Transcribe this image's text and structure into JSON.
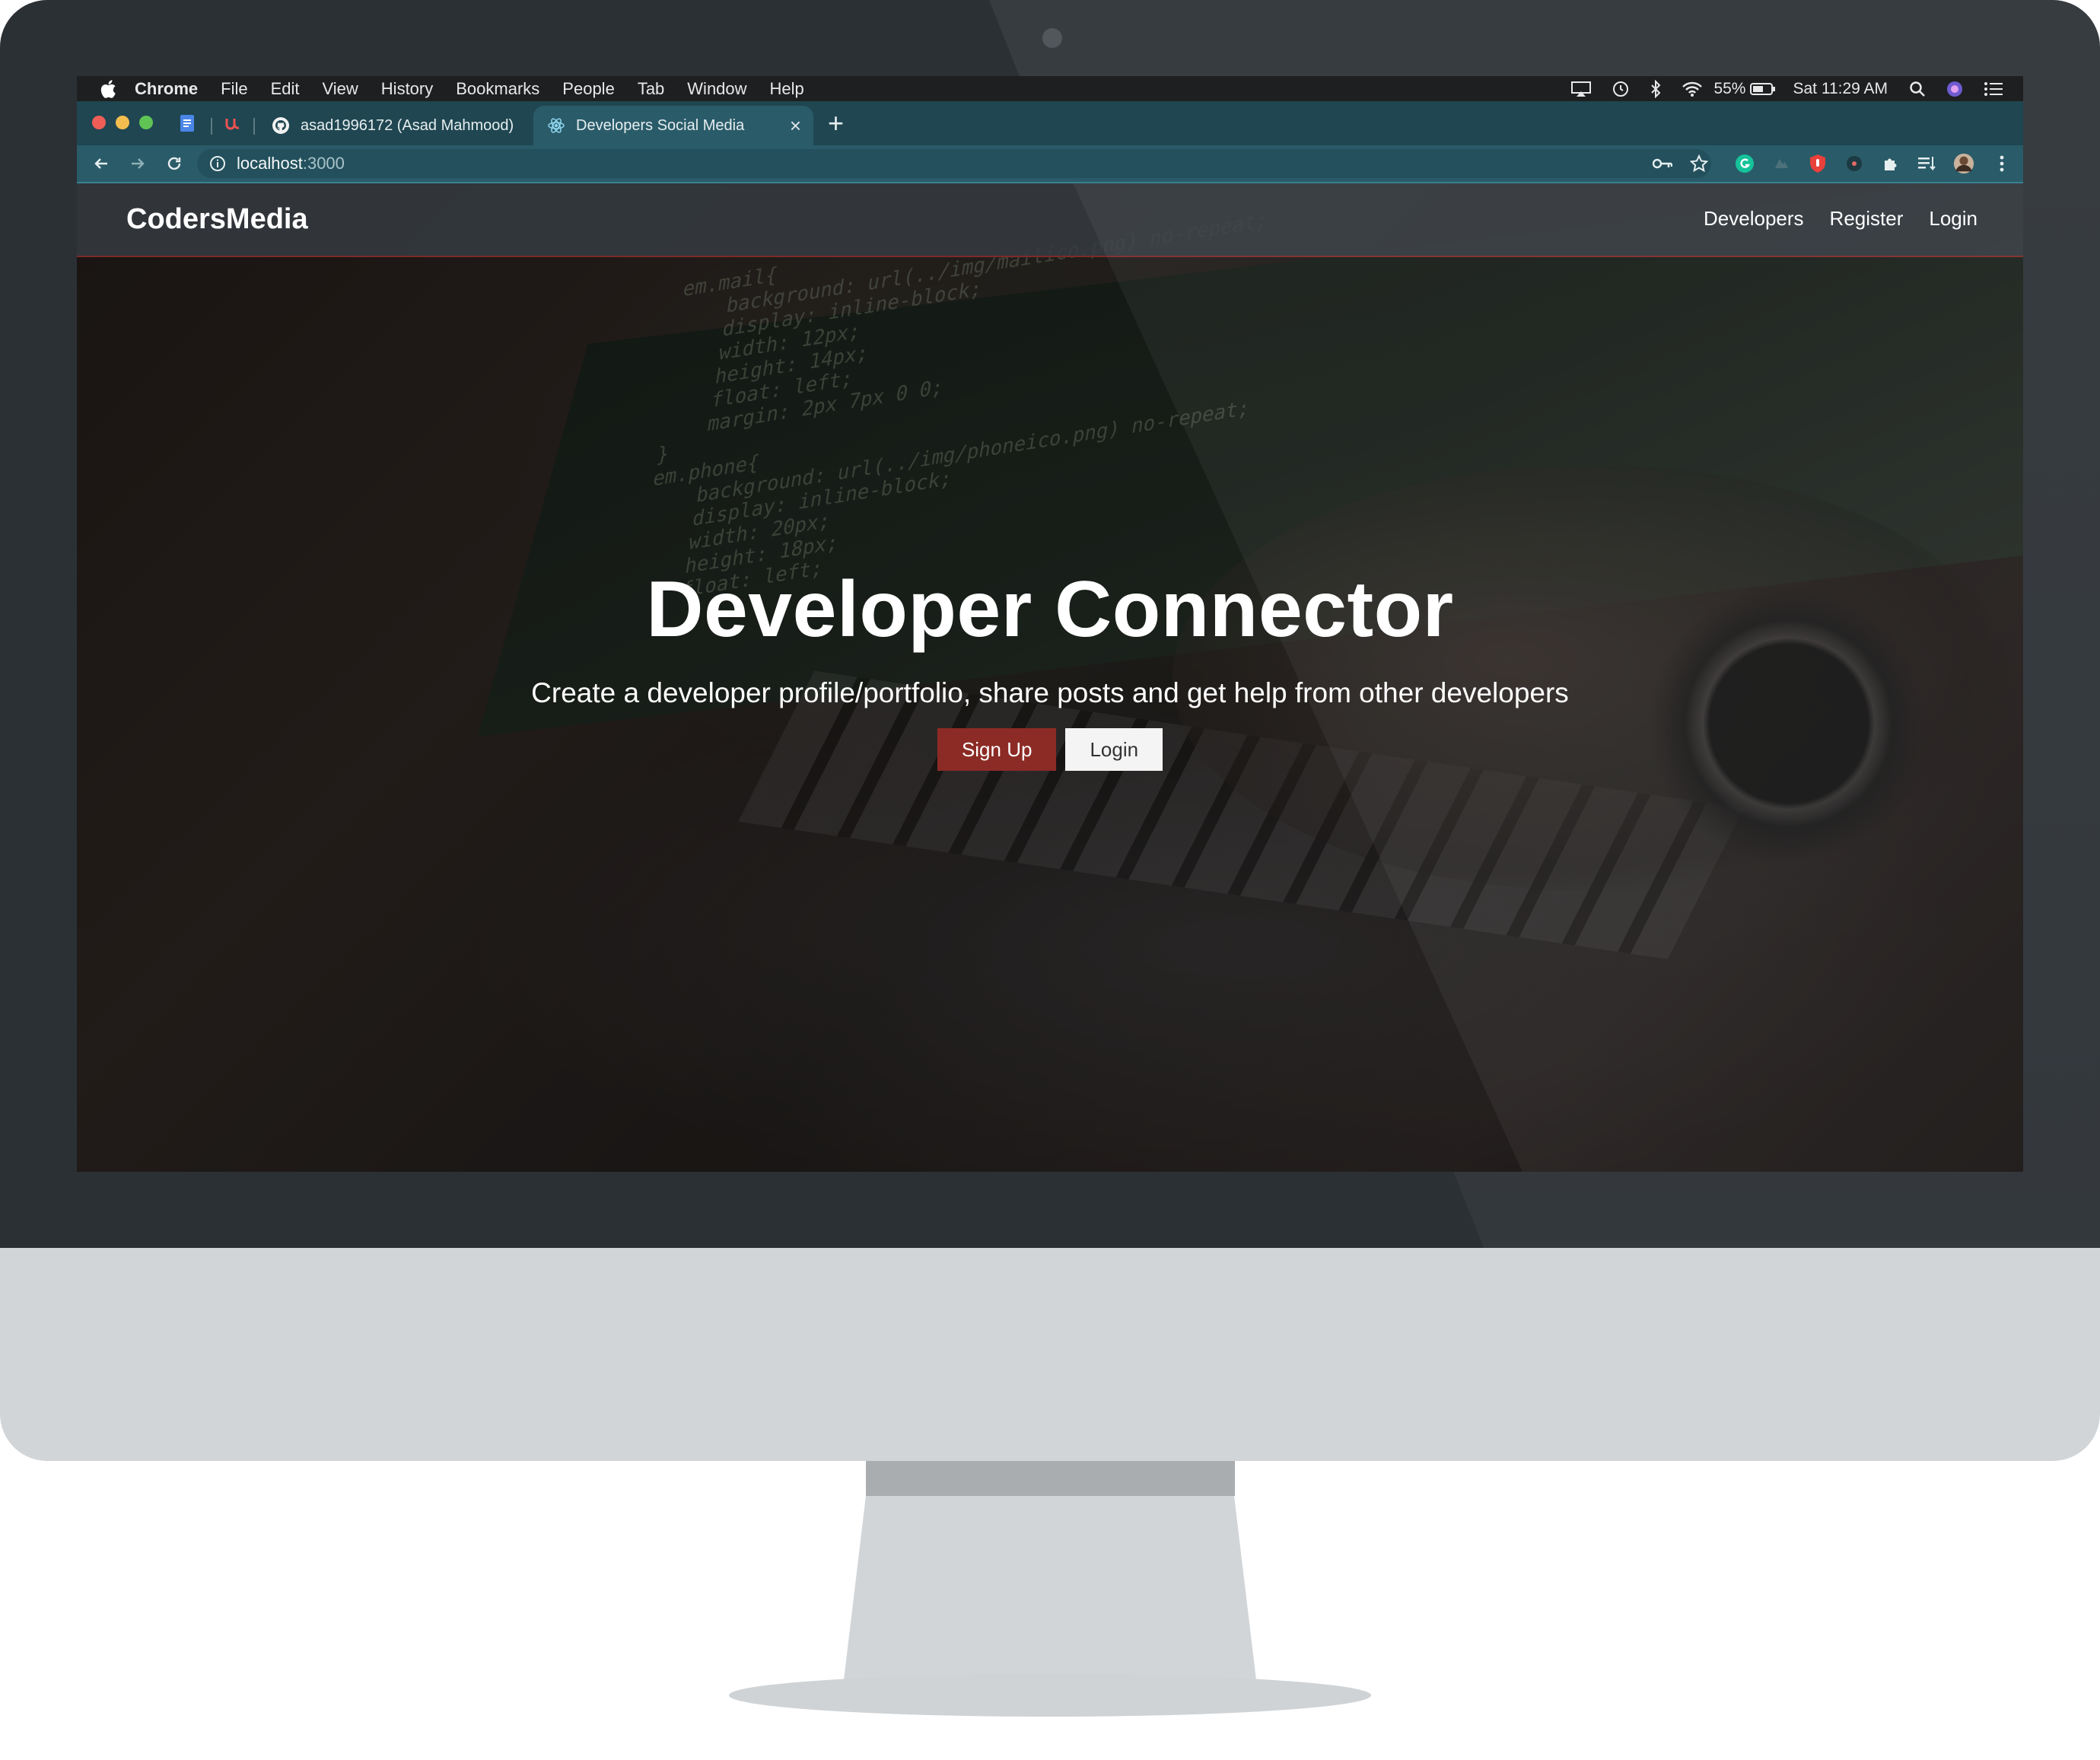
{
  "menubar": {
    "app_name": "Chrome",
    "items": [
      "File",
      "Edit",
      "View",
      "History",
      "Bookmarks",
      "People",
      "Tab",
      "Window",
      "Help"
    ],
    "battery": "55%",
    "clock": "Sat 11:29 AM"
  },
  "tabs": [
    {
      "title": "asad1996172 (Asad Mahmood)",
      "icon": "github-icon"
    },
    {
      "title": "Developers Social Media",
      "icon": "react-icon"
    }
  ],
  "address": {
    "host": "localhost",
    "port": ":3000"
  },
  "navbar": {
    "brand": "CodersMedia",
    "links": [
      "Developers",
      "Register",
      "Login"
    ]
  },
  "hero": {
    "title": "Developer Connector",
    "lead": "Create a developer profile/portfolio, share posts and get help from other developers",
    "signup_label": "Sign Up",
    "login_label": "Login"
  },
  "colors": {
    "primary": "#8c2b25",
    "navbar": "#343a40",
    "chrome_theme": "#2a5b69"
  }
}
